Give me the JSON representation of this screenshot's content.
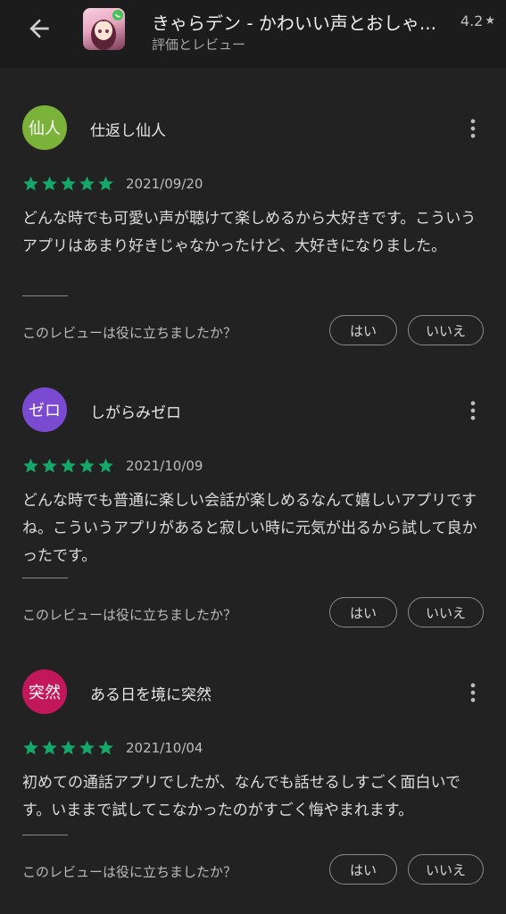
{
  "header": {
    "title": "きゃらデン - かわいい声とおしゃ...",
    "subtitle": "評価とレビュー",
    "rating": "4.2",
    "back_icon": "arrow-back-icon",
    "app_icon": "app-icon"
  },
  "colors": {
    "star": "#14a86a",
    "avatar_1": "#7bb23a",
    "avatar_2": "#7a4bd1",
    "avatar_3": "#c2185b"
  },
  "reviews": [
    {
      "avatar_text": "仙人",
      "username": "仕返し仙人",
      "stars": 5,
      "date": "2021/09/20",
      "text": "どんな時でも可愛い声が聴けて楽しめるから大好きです。こういうアプリはあまり好きじゃなかったけど、大好きになりました。",
      "helpful_question": "このレビューは役に立ちましたか？",
      "yes_label": "はい",
      "no_label": "いいえ"
    },
    {
      "avatar_text": "ゼロ",
      "username": "しがらみゼロ",
      "stars": 5,
      "date": "2021/10/09",
      "text": "どんな時でも普通に楽しい会話が楽しめるなんて嬉しいアプリですね。こういうアプリがあると寂しい時に元気が出るから試して良かったです。",
      "helpful_question": "このレビューは役に立ちましたか？",
      "yes_label": "はい",
      "no_label": "いいえ"
    },
    {
      "avatar_text": "突然",
      "username": "ある日を境に突然",
      "stars": 5,
      "date": "2021/10/04",
      "text": "初めての通話アプリでしたが、なんでも話せるしすごく面白いです。いままで試してこなかったのがすごく悔やまれます。",
      "helpful_question": "このレビューは役に立ちましたか？",
      "yes_label": "はい",
      "no_label": "いいえ"
    }
  ]
}
